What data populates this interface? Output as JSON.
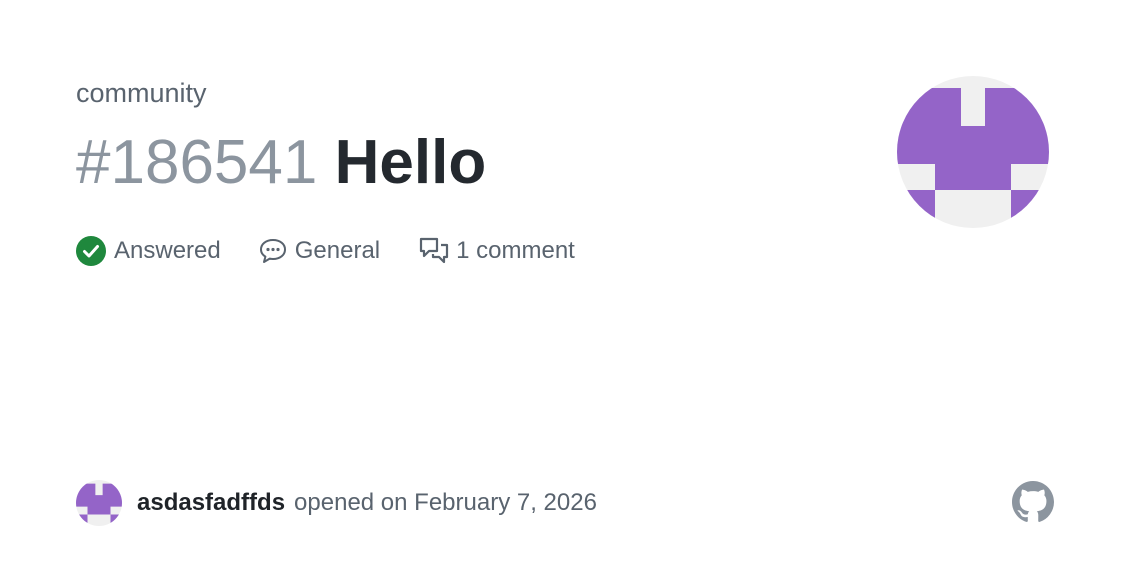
{
  "repo": {
    "name": "community"
  },
  "issue": {
    "number": "#186541",
    "title": "Hello"
  },
  "meta": {
    "status": {
      "label": "Answered",
      "icon": "check-circle-icon",
      "color": "#1f883d"
    },
    "category": {
      "label": "General",
      "icon": "speech-balloon-icon"
    },
    "comments": {
      "label": "1 comment",
      "icon": "comment-discussion-icon"
    }
  },
  "footer": {
    "author": "asdasfadffds",
    "opened_text": "opened on February 7, 2026"
  },
  "colors": {
    "avatar_fg": "#9464c8",
    "avatar_bg": "#f0f0f0",
    "muted": "#59636e",
    "number": "#8c959f",
    "title": "#24292f"
  },
  "brand": {
    "icon": "github-logo-icon"
  }
}
